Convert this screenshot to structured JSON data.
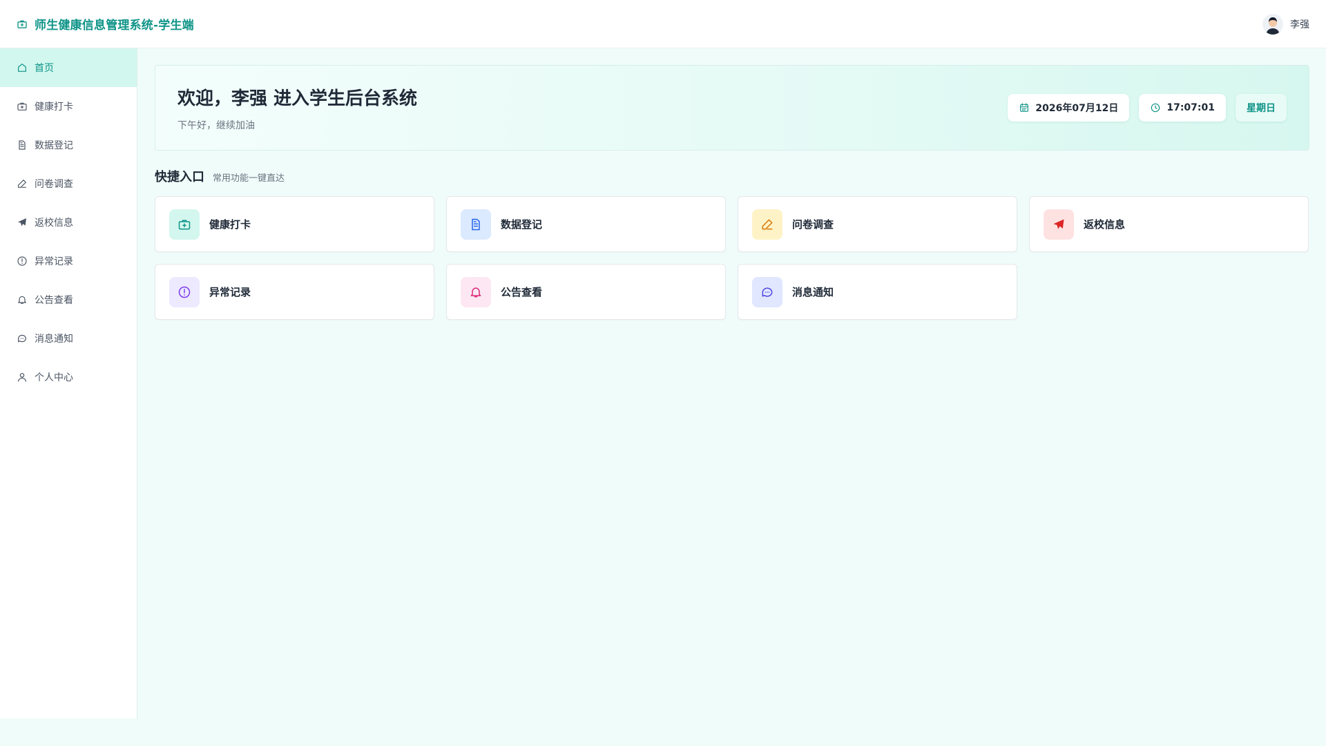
{
  "app": {
    "title": "师生健康信息管理系统-学生端",
    "accent": "#0f9488"
  },
  "user": {
    "name": "李强"
  },
  "sidebar": {
    "items": [
      {
        "label": "首页",
        "icon": "home-icon",
        "active": true
      },
      {
        "label": "健康打卡",
        "icon": "medical-kit-icon"
      },
      {
        "label": "数据登记",
        "icon": "document-icon"
      },
      {
        "label": "问卷调查",
        "icon": "pen-icon"
      },
      {
        "label": "返校信息",
        "icon": "send-icon"
      },
      {
        "label": "异常记录",
        "icon": "alert-circle-icon"
      },
      {
        "label": "公告查看",
        "icon": "bell-icon"
      },
      {
        "label": "消息通知",
        "icon": "chat-icon"
      },
      {
        "label": "个人中心",
        "icon": "user-icon"
      }
    ]
  },
  "welcome": {
    "title": "欢迎，李强 进入学生后台系统",
    "subtitle": "下午好，继续加油",
    "date": "2026年07月12日",
    "time": "17:07:01",
    "weekday": "星期日"
  },
  "quick": {
    "title": "快捷入口",
    "subtitle": "常用功能一键直达",
    "cards": [
      {
        "label": "健康打卡",
        "icon": "medical-kit-icon",
        "bg": "#d3f7ee",
        "color": "#0f9488"
      },
      {
        "label": "数据登记",
        "icon": "document-icon",
        "bg": "#dbeafe",
        "color": "#2563eb"
      },
      {
        "label": "问卷调查",
        "icon": "pen-icon",
        "bg": "#fef3c7",
        "color": "#d97706"
      },
      {
        "label": "返校信息",
        "icon": "send-icon",
        "bg": "#fee2e2",
        "color": "#dc2626"
      },
      {
        "label": "异常记录",
        "icon": "alert-circle-icon",
        "bg": "#ede9fe",
        "color": "#7c3aed"
      },
      {
        "label": "公告查看",
        "icon": "bell-icon",
        "bg": "#fce7f3",
        "color": "#db2777"
      },
      {
        "label": "消息通知",
        "icon": "chat-icon",
        "bg": "#e0e7ff",
        "color": "#4f46e5"
      }
    ]
  }
}
